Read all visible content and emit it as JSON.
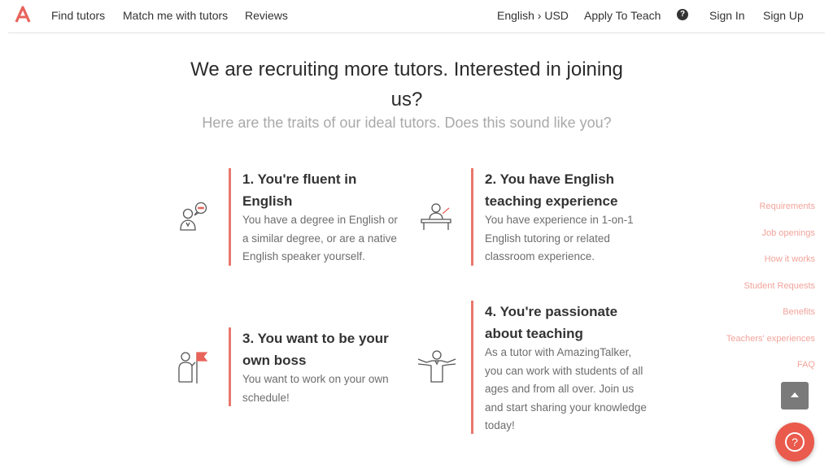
{
  "header": {
    "nav": [
      "Find tutors",
      "Match me with tutors",
      "Reviews"
    ],
    "locale": "English › USD",
    "apply": "Apply To Teach",
    "help_glyph": "?",
    "sign_in": "Sign In",
    "sign_up": "Sign Up"
  },
  "hero": {
    "title": "We are recruiting more tutors. Interested in joining us?",
    "subtitle": "Here are the traits of our ideal tutors. Does this sound like you?"
  },
  "traits": [
    {
      "title": "1. You're fluent in English",
      "desc": "You have a degree in English or a similar degree, or are a native English speaker yourself.",
      "icon": "speech-person-icon"
    },
    {
      "title": "2. You have English teaching experience",
      "desc": "You have experience in 1-on-1 English tutoring or related classroom experience.",
      "icon": "teacher-desk-icon"
    },
    {
      "title": "3. You want to be your own boss",
      "desc": "You want to work on your own schedule!",
      "icon": "flag-person-icon"
    },
    {
      "title": "4. You're passionate about teaching",
      "desc": "As a tutor with AmazingTalker, you can work with students of all ages and from all over. Join us and start sharing your knowledge today!",
      "icon": "open-arms-person-icon"
    }
  ],
  "side_nav": [
    "Requirements",
    "Job openings",
    "How it works",
    "Student Requests",
    "Benefits",
    "Teachers' experiences",
    "FAQ"
  ],
  "help_fab_glyph": "?",
  "colors": {
    "accent": "#e8786d",
    "side_link": "#f2a39b",
    "fab": "#ea5a4d"
  }
}
